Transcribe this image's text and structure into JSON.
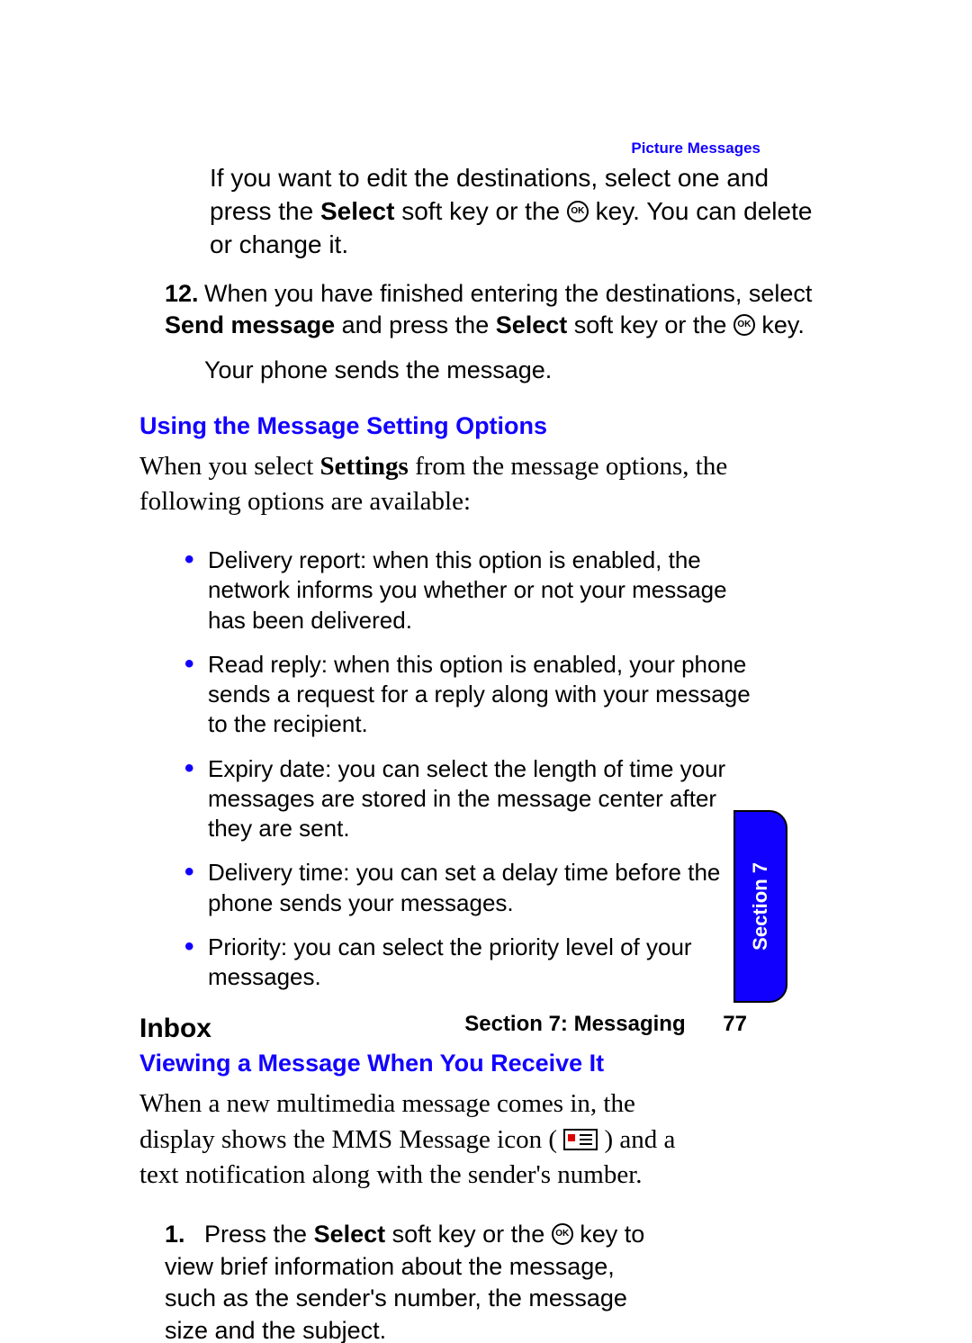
{
  "header": {
    "topic": "Picture Messages"
  },
  "intro_paras": [
    {
      "plain_html": "If you want to edit the destinations, select one and press the <b>Select</b> soft key or the {OK} key. You can delete or change it."
    }
  ],
  "step12": {
    "number": "12.",
    "html": "When you have finished entering the destinations, select <b>Send message</b> and press the <b>Select</b> soft key or the {OK} key.",
    "after": "Your phone sends the message."
  },
  "heading_settings": "Using the Message Setting Options",
  "settings_intro_html": "When you select <b>Settings</b> from the message options, the following options are available:",
  "bullets": [
    "Delivery report: when this option is enabled, the network informs you whether or not your message has been delivered.",
    "Read reply: when this option is enabled, your phone sends a request for a reply along with your message to the recipient.",
    "Expiry date: you can select the length of time your messages are stored in the message center after they are sent.",
    "Delivery time: you can set a delay time before the phone sends your messages.",
    "Priority: you can select the priority level of your messages."
  ],
  "heading_inbox": "Inbox",
  "heading_viewing": "Viewing a Message When You Receive It",
  "inbox_intro_html": "When a new multimedia message comes in, the display shows the MMS Message icon ( {MMS} ) and a text notification along with the sender's number.",
  "step1": {
    "number": "1.",
    "html": "Press the <b>Select</b> soft key or the {OK} key to view brief information about the message, such as the sender's number, the message size and the subject."
  },
  "tab": "Section 7",
  "footer": {
    "label": "Section 7: Messaging",
    "page": "77"
  },
  "icons": {
    "ok_label": "OK"
  }
}
